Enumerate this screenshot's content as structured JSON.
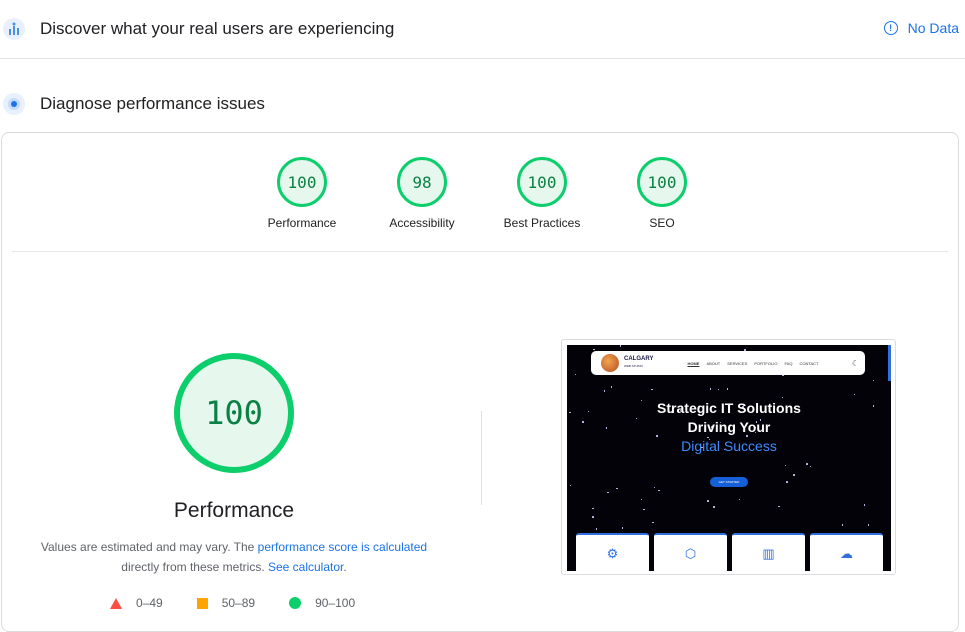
{
  "crux": {
    "title": "Discover what your real users are experiencing",
    "status": "No Data",
    "icon": "people-chart-icon",
    "info_icon": "info-icon"
  },
  "lab": {
    "title": "Diagnose performance issues",
    "icon": "lab-flask-icon"
  },
  "categories": [
    {
      "score": "100",
      "label": "Performance"
    },
    {
      "score": "98",
      "label": "Accessibility"
    },
    {
      "score": "100",
      "label": "Best Practices"
    },
    {
      "score": "100",
      "label": "SEO"
    }
  ],
  "main": {
    "score": "100",
    "title": "Performance",
    "note_prefix": "Values are estimated and may vary. The ",
    "note_link1": "performance score is calculated",
    "note_middle": " directly from these metrics. ",
    "note_link2": "See calculator",
    "note_suffix": "."
  },
  "legend": [
    {
      "range": "0–49",
      "shape": "triangle",
      "color": "#ff4e42"
    },
    {
      "range": "50–89",
      "shape": "square",
      "color": "#ffa400"
    },
    {
      "range": "90–100",
      "shape": "circle",
      "color": "#0cce6b"
    }
  ],
  "screenshot": {
    "logo_line1": "CALGARY",
    "logo_line2": "WEB STUDIO",
    "nav_links": [
      "HOME",
      "ABOUT",
      "SERVICES",
      "PORTFOLIO",
      "FAQ",
      "CONTACT"
    ],
    "hero_line1": "Strategic IT Solutions",
    "hero_line2": "Driving Your",
    "hero_line3": "Digital Success",
    "cta": "GET STARTED",
    "card_icons": [
      "gear-icon",
      "shield-icon",
      "chart-icon",
      "cloud-icon"
    ]
  },
  "colors": {
    "pass": "#0cce6b",
    "link": "#1a73e8",
    "average": "#ffa400",
    "fail": "#ff4e42"
  }
}
